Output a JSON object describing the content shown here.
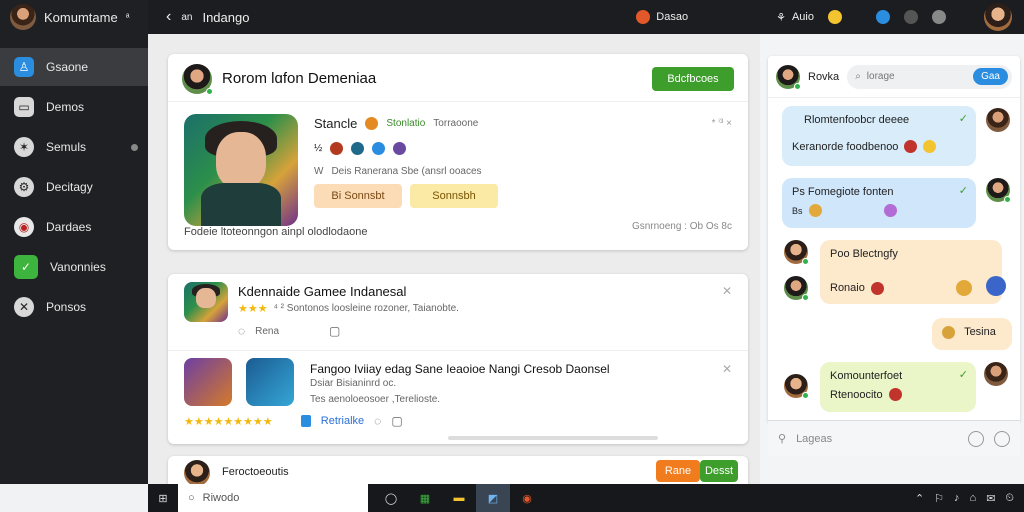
{
  "sidebar": {
    "profile_name": "Komumtame",
    "profile_suffix": "ᵃ",
    "items": [
      {
        "label": "Gsaone",
        "icon": "user-icon"
      },
      {
        "label": "Demos",
        "icon": "inbox-icon"
      },
      {
        "label": "Semuls",
        "icon": "star-icon"
      },
      {
        "label": "Decitagy",
        "icon": "settings-icon"
      },
      {
        "label": "Dardaes",
        "icon": "shield-icon"
      },
      {
        "label": "Vanonnies",
        "icon": "check-icon"
      },
      {
        "label": "Ponsos",
        "icon": "close-icon"
      }
    ]
  },
  "topbar": {
    "back_glyph": "‹",
    "prefix": "an",
    "title": "Indango",
    "status_label": "Dasao",
    "audio_label": "Auio"
  },
  "main_card": {
    "title": "Rorom lɑfon Demeniaa",
    "action_label": "Bdcfbcoes",
    "game_name": "Stancle",
    "game_meta_1": "Stonlatio",
    "game_meta_2": "Torraoone",
    "row_prefix": "½",
    "tags_prefix": "W",
    "tags_text": "Deis Ranerana Sbe (ansrl ooaces",
    "btn1_label": "Bi Sonnsbt",
    "btn2_label": "Sonnsbh",
    "corner_meta": "* ⁱ³ ×",
    "footer_left": "Fodeie ltoteonngon ainpl olodlodaone",
    "footer_right": "Gsnrnoeng : Ob Os 8c"
  },
  "feed_card": {
    "post1_title": "Kdennaide Gamee Indanesal",
    "post1_rating_text": "⁴ ² Sontonos loosleine rozoner, Taianobte.",
    "post1_comment": "Rena",
    "post2_title": "Fangoo Iviiay edag Sane Ieaoioe Nangi Cresob Daonsel",
    "post2_sub1": "Dsiar Bisianinrd oc.",
    "post2_sub2": "Tes aenoloeosoer ,Terelioste.",
    "post2_link": "Retrialke"
  },
  "bottom_card": {
    "text": "Feroctoeoutis",
    "btn1_label": "Rane",
    "btn2_label": "Desst"
  },
  "chat": {
    "header_name": "Rovka",
    "search_placeholder": "lorage",
    "search_button": "Gaa",
    "messages": [
      {
        "line1": "Rlomtenfoobcr deeee",
        "line2": "Keranorde foodbenoo"
      },
      {
        "line1": "Ps Fomegiote fonten",
        "line2": "Bs"
      },
      {
        "line1": "Poo Blectngfy",
        "line2": "Ronaio"
      },
      {
        "line1": "Tesina"
      },
      {
        "line1": "Komounterfoet",
        "line2": "Rtenoocito"
      }
    ],
    "composer_placeholder": "Lageas"
  },
  "taskbar": {
    "search_placeholder": "Riwodo"
  },
  "colors": {
    "accent_green": "#3e9e2c",
    "accent_orange": "#f07c1e",
    "accent_blue": "#2a8de0"
  }
}
